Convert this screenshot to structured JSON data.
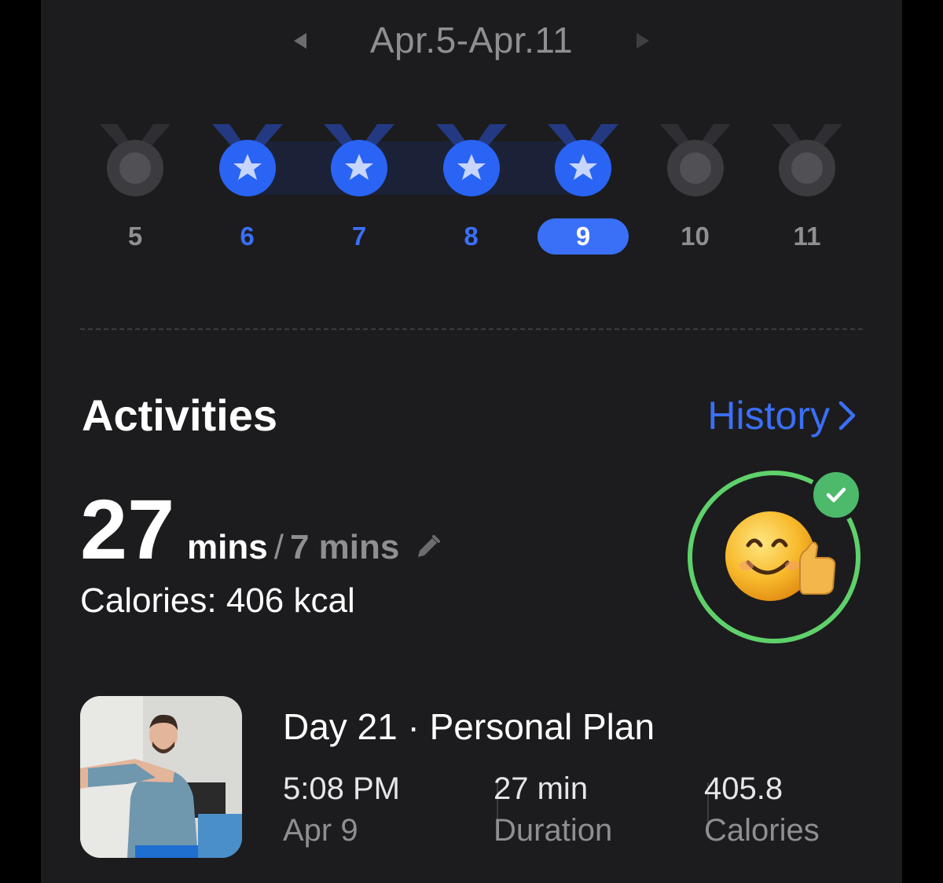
{
  "week": {
    "range_label": "Apr.5-Apr.11",
    "days": [
      {
        "label": "5",
        "completed": false,
        "selected": false
      },
      {
        "label": "6",
        "completed": true,
        "selected": false
      },
      {
        "label": "7",
        "completed": true,
        "selected": false
      },
      {
        "label": "8",
        "completed": true,
        "selected": false
      },
      {
        "label": "9",
        "completed": true,
        "selected": true
      },
      {
        "label": "10",
        "completed": false,
        "selected": false
      },
      {
        "label": "11",
        "completed": false,
        "selected": false
      }
    ]
  },
  "activities": {
    "title": "Activities",
    "history_label": "History",
    "minutes_value": "27",
    "minutes_unit": "mins",
    "slash": "/",
    "goal_label": "7 mins",
    "calories_label": "Calories: 406 kcal",
    "goal_met": true
  },
  "record": {
    "title": "Day 21 · Personal Plan",
    "time_value": "5:08 PM",
    "time_label": "Apr 9",
    "duration_value": "27 min",
    "duration_label": "Duration",
    "calories_value": "405.8",
    "calories_label": "Calories"
  },
  "colors": {
    "accent": "#3a6ff7",
    "success": "#4cb96b",
    "background": "#1c1c1e",
    "muted": "#8e8e93"
  },
  "icons": {
    "prev": "chevron-left-icon",
    "next": "chevron-right-icon",
    "medal_done": "star-medal-icon",
    "medal_pending": "empty-medal-icon",
    "edit": "pencil-icon",
    "badge": "check-icon",
    "emoji": "smiling-thumbs-up-emoji"
  }
}
